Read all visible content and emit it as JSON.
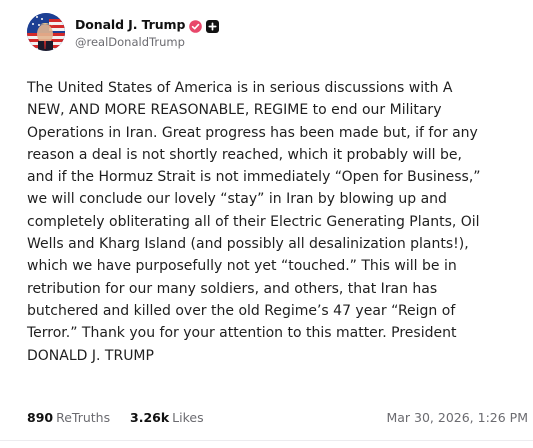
{
  "author": {
    "display_name": "Donald J. Trump",
    "handle": "@realDonaldTrump",
    "verified_badge_color": "#e8486b"
  },
  "post": {
    "lines": [
      "The United States of America is in serious discussions with A",
      "NEW, AND MORE REASONABLE, REGIME to end our Military",
      "Operations in Iran. Great progress has been made but, if for any",
      "reason a deal is not shortly reached, which it probably will be,",
      "and if the Hormuz Strait is not immediately “Open for Business,”",
      "we will conclude our lovely “stay” in Iran by blowing up and",
      "completely obliterating all of their Electric Generating Plants, Oil",
      "Wells and Kharg Island (and possibly all desalinization plants!),",
      "which we have purposefully not yet “touched.” This will be in",
      "retribution for our many soldiers, and others, that Iran has",
      "butchered and killed over the old Regime’s 47 year “Reign of",
      "Terror.” Thank you for your attention to this matter. President",
      "DONALD J. TRUMP"
    ]
  },
  "stats": {
    "retruths_count": "890",
    "retruths_label": "ReTruths",
    "likes_count": "3.26k",
    "likes_label": "Likes",
    "timestamp": "Mar 30, 2026, 1:26 PM"
  },
  "icons": {
    "avatar": "flag-portrait-avatar",
    "verified": "verified-badge-icon",
    "plus": "plus-badge-icon"
  }
}
